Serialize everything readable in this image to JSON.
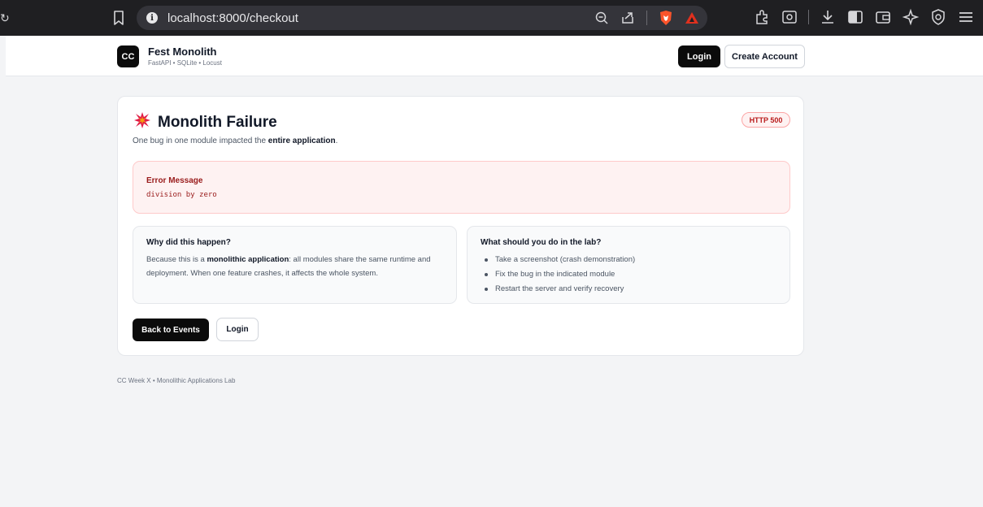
{
  "browser": {
    "url": "localhost:8000/checkout"
  },
  "app": {
    "logo_text": "CC",
    "brand_title": "Fest Monolith",
    "brand_subtitle": "FastAPI • SQLite • Locust",
    "nav": {
      "login_label": "Login",
      "create_account_label": "Create Account"
    }
  },
  "error_page": {
    "title": "Monolith Failure",
    "subtitle_prefix": "One bug in one module impacted the ",
    "subtitle_bold": "entire application",
    "subtitle_suffix": ".",
    "status_badge": "HTTP 500",
    "error_box": {
      "label": "Error Message",
      "message": "division by zero"
    },
    "why": {
      "title": "Why did this happen?",
      "body_prefix": "Because this is a ",
      "body_bold": "monolithic application",
      "body_suffix": ": all modules share the same runtime and deployment. When one feature crashes, it affects the whole system."
    },
    "lab": {
      "title": "What should you do in the lab?",
      "items": [
        "Take a screenshot (crash demonstration)",
        "Fix the bug in the indicated module",
        "Restart the server and verify recovery"
      ]
    },
    "actions": {
      "back_label": "Back to Events",
      "login_label": "Login"
    }
  },
  "footer": {
    "text": "CC Week X • Monolithic Applications Lab"
  },
  "colors": {
    "accent_dark": "#0b0b0b",
    "error_bg": "#fef2f2",
    "error_text": "#991b1b",
    "burst_icon": "#e11d48"
  },
  "icons": [
    "bookmark-icon",
    "info-icon",
    "zoom-out-icon",
    "share-icon",
    "brave-shield-icon",
    "rewards-icon",
    "extensions-icon",
    "screenshot-icon",
    "download-icon",
    "sidebar-icon",
    "wallet-icon",
    "leo-icon",
    "vpn-icon",
    "menu-icon",
    "burst-icon"
  ]
}
